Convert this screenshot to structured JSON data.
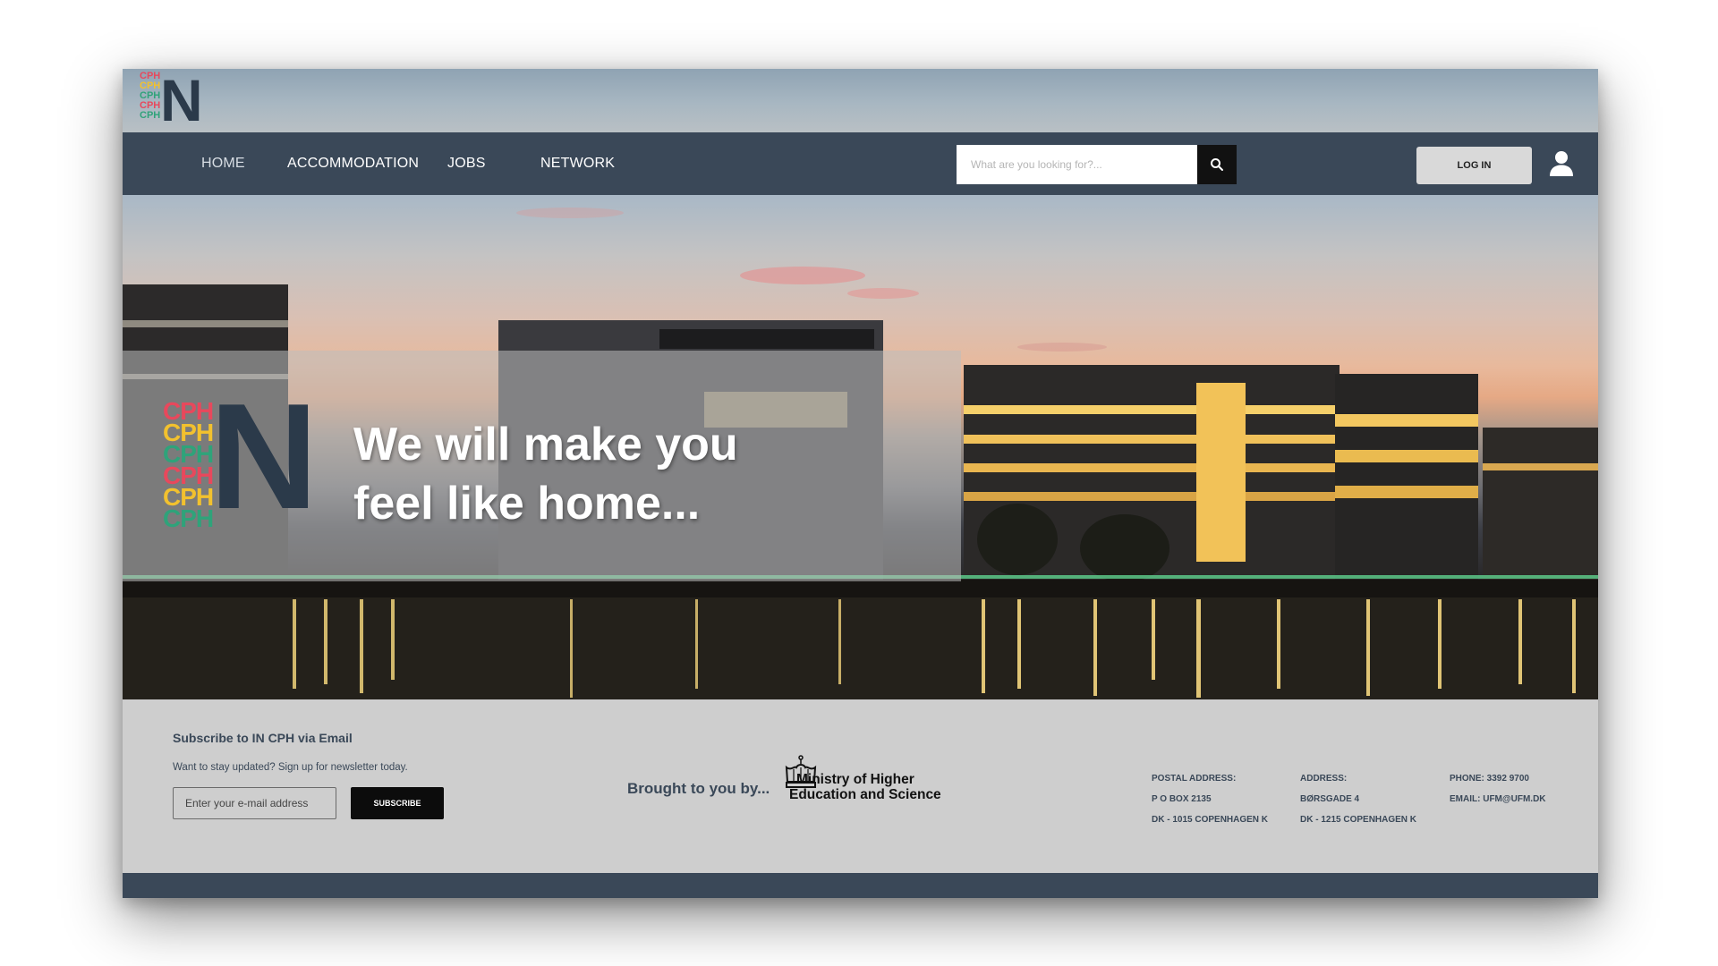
{
  "nav": {
    "items": [
      {
        "label": "HOME"
      },
      {
        "label": "ACCOMMODATION"
      },
      {
        "label": "JOBS"
      },
      {
        "label": "NETWORK"
      }
    ],
    "search_placeholder": "What are you looking for?...",
    "login_label": "LOG IN"
  },
  "logo": {
    "stack": [
      "CPH",
      "CPH",
      "CPH",
      "CPH",
      "CPH",
      "CPH"
    ],
    "letter": "N",
    "colors": [
      "#e8485c",
      "#f2c12e",
      "#2fa37a",
      "#e8485c",
      "#f2c12e",
      "#2fa37a"
    ]
  },
  "hero": {
    "headline_line1": "We will make you",
    "headline_line2": "feel like home..."
  },
  "footer": {
    "subscribe_title": "Subscribe to IN CPH via Email",
    "subscribe_text": "Want to stay updated? Sign up for newsletter today.",
    "email_placeholder": "Enter your e-mail address",
    "subscribe_button": "SUBSCRIBE",
    "brought_by": "Brought to you by...",
    "ministry_line1": "Ministry of Higher",
    "ministry_line2": "Education and Science",
    "postal": {
      "label": "POSTAL ADDRESS:",
      "line1": "P O BOX 2135",
      "line2": "DK - 1015 COPENHAGEN K"
    },
    "address": {
      "label": "ADDRESS:",
      "line1": "BØRSGADE 4",
      "line2": "DK - 1215 COPENHAGEN K"
    },
    "contact": {
      "phone": "PHONE: 3392 9700",
      "email": "EMAIL: UFM@UFM.DK"
    }
  },
  "colors": {
    "nav_bg": "#3a4858",
    "footer_bg": "#cecece",
    "accent_red": "#e8485c",
    "accent_yellow": "#f2c12e",
    "accent_green": "#2fa37a"
  }
}
